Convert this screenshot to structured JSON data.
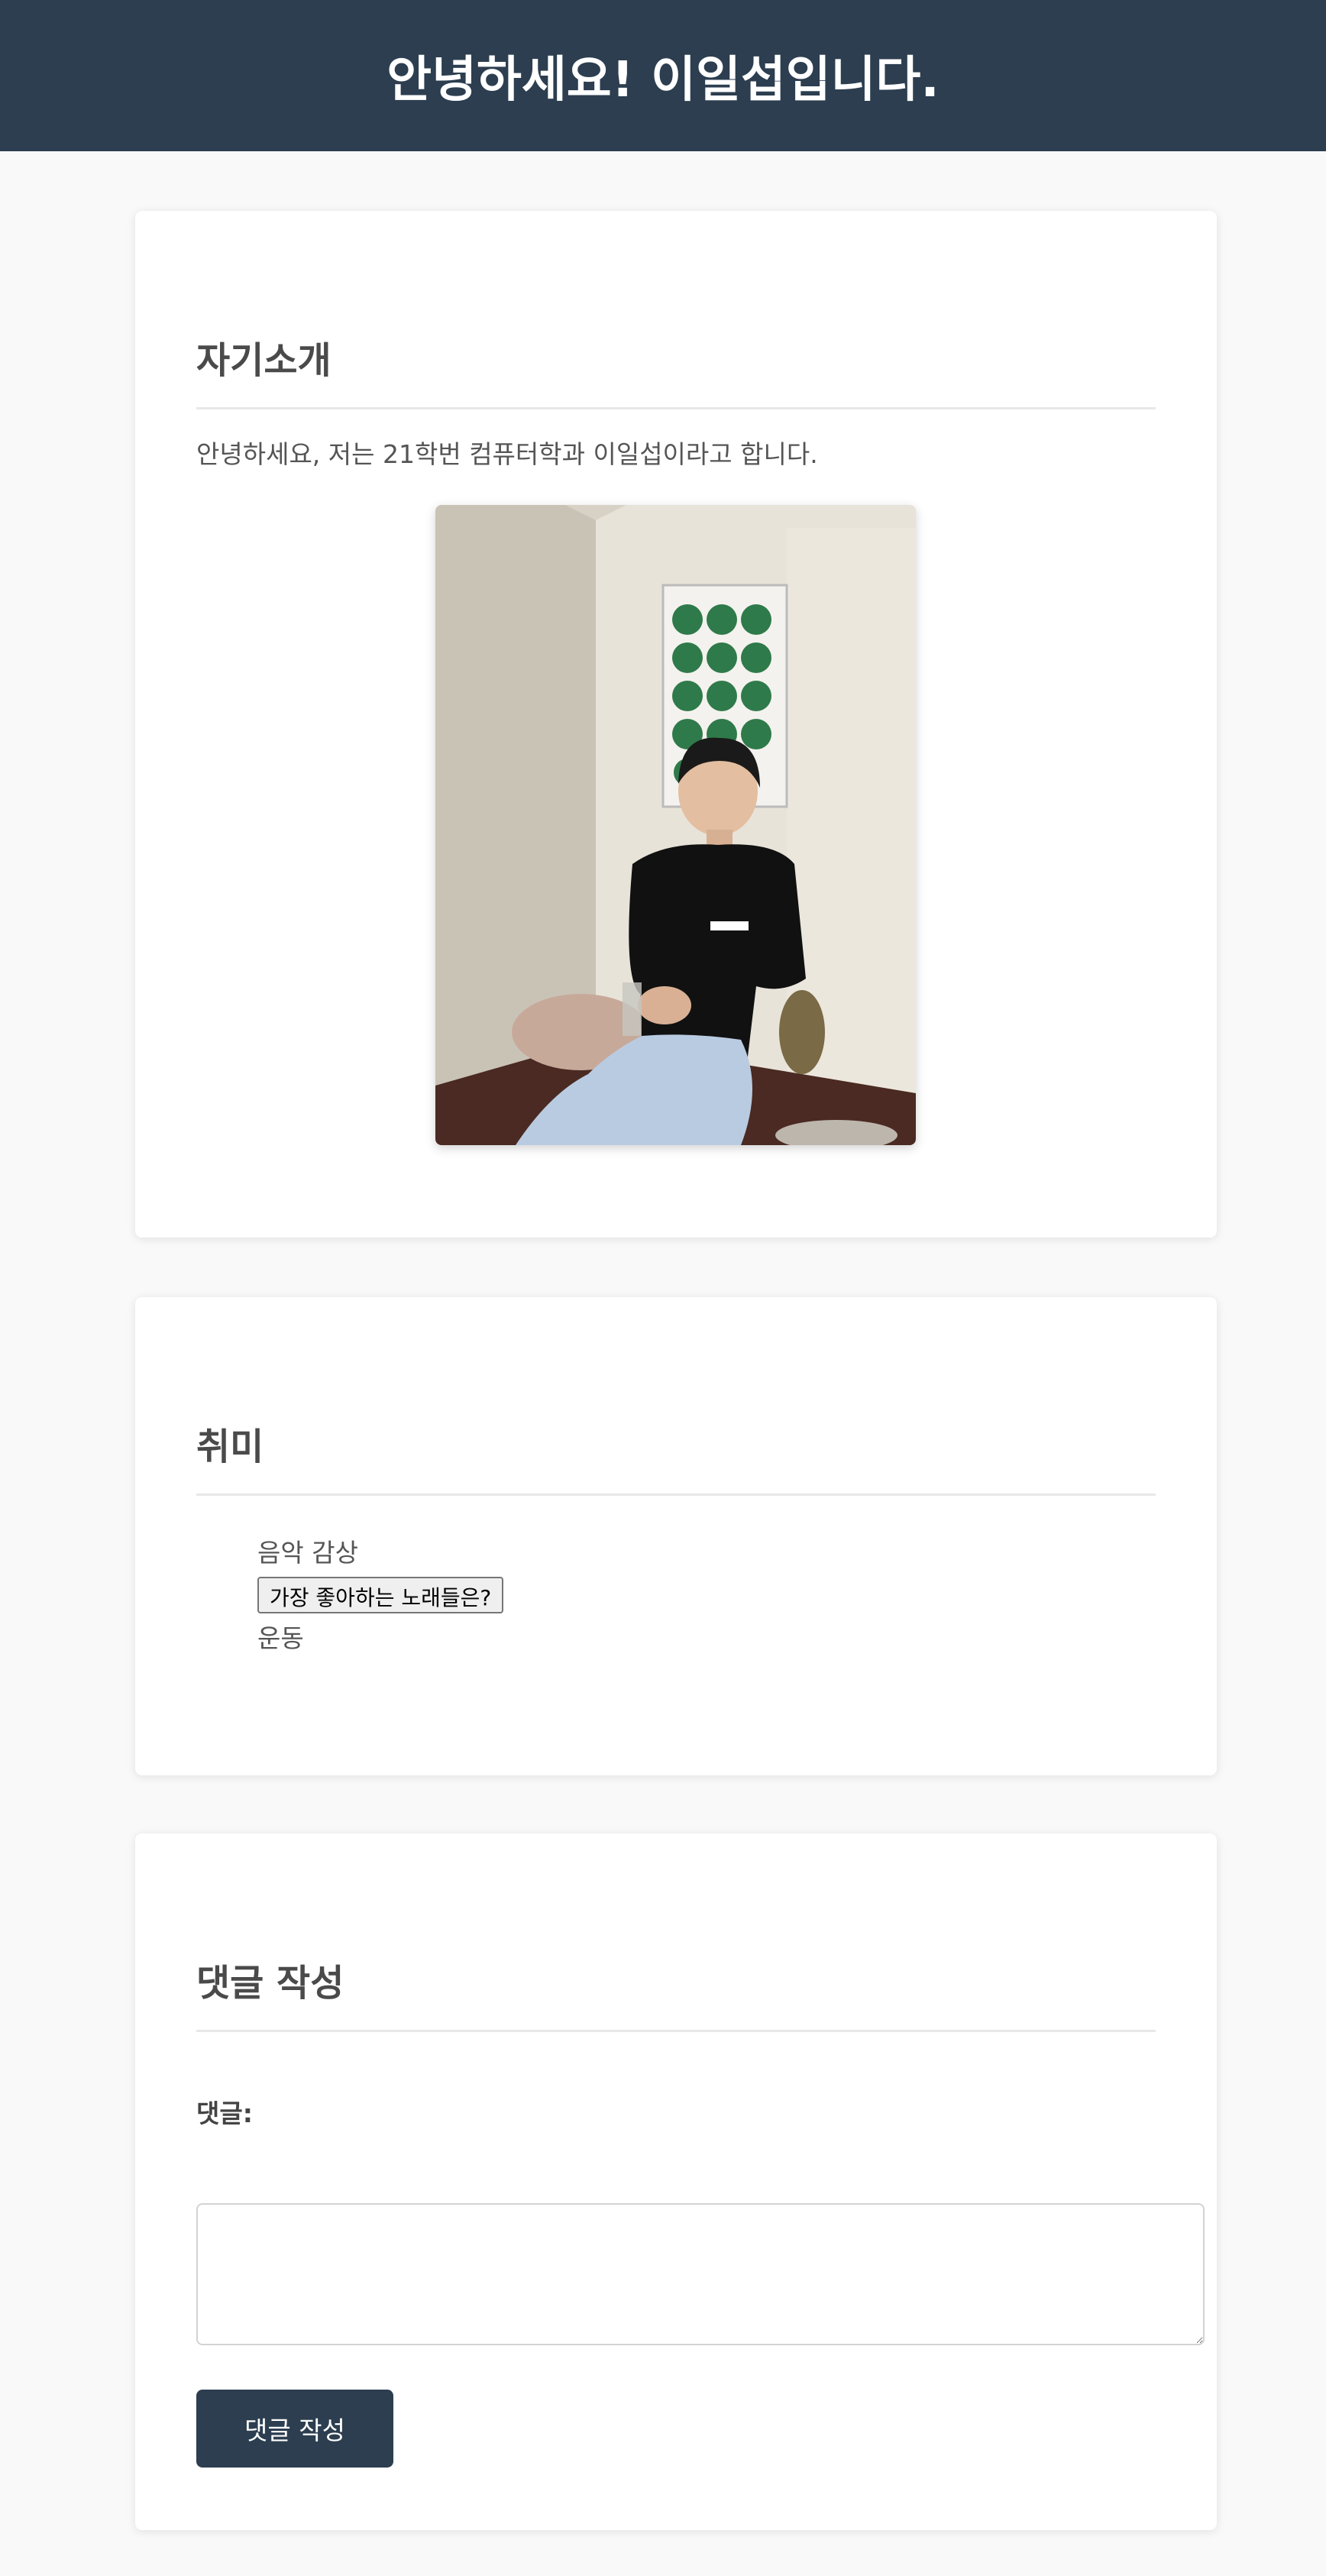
{
  "header": {
    "title": "안녕하세요! 이일섭입니다.",
    "background": "#2c3e50"
  },
  "intro": {
    "heading": "자기소개",
    "text": "안녕하세요, 저는 21학번 컴퓨터학과 이일섭이라고 합니다.",
    "photo_icon": "profile-photo"
  },
  "hobbies": {
    "heading": "취미",
    "items": [
      "음악 감상",
      "운동"
    ],
    "song_button_label": "가장 좋아하는 노래들은?"
  },
  "comment": {
    "heading": "댓글 작성",
    "label": "댓글:",
    "textarea_value": "",
    "submit_label": "댓글 작성",
    "button_color": "#2c3e50"
  }
}
